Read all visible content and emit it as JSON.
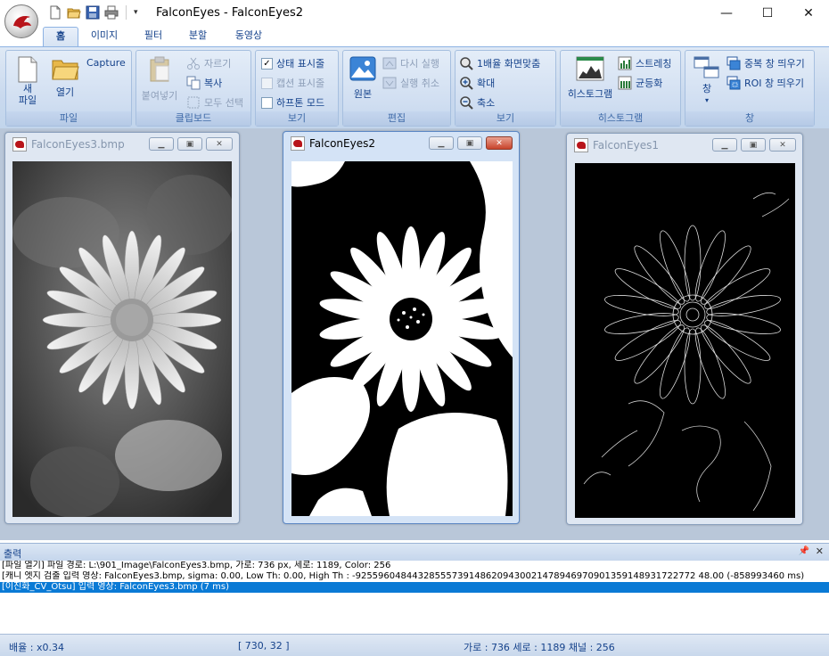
{
  "window": {
    "title": "FalconEyes - FalconEyes2"
  },
  "quick_access": {
    "icons": [
      "new-doc-icon",
      "open-folder-icon",
      "save-icon",
      "print-icon"
    ],
    "dropdown": "▾"
  },
  "window_controls": {
    "minimize": "—",
    "maximize": "☐",
    "close": "✕"
  },
  "tabs": [
    {
      "label": "홈",
      "active": true
    },
    {
      "label": "이미지",
      "active": false
    },
    {
      "label": "필터",
      "active": false
    },
    {
      "label": "분할",
      "active": false
    },
    {
      "label": "동영상",
      "active": false
    }
  ],
  "ribbon": {
    "file": {
      "label": "파일",
      "new_line1": "새",
      "new_line2": "파일",
      "open": "열기",
      "capture": "Capture"
    },
    "clipboard": {
      "label": "클립보드",
      "paste": "붙여넣기",
      "cut": "자르기",
      "copy": "복사",
      "select_all": "모두 선택"
    },
    "view1": {
      "label": "보기",
      "statusbar": "상태 표시줄",
      "captionbar": "캡션 표시줄",
      "halftone": "하프톤 모드"
    },
    "edit": {
      "label": "편집",
      "original": "원본",
      "redo": "다시 실행",
      "undo": "실행 취소"
    },
    "view2": {
      "label": "보기",
      "fit": "1배율  화면맞춤",
      "zoom_in": "확대",
      "zoom_out": "축소"
    },
    "histogram": {
      "label": "히스토그램",
      "histogram": "히스토그램",
      "stretching": "스트레칭",
      "equalize": "균등화"
    },
    "window": {
      "label": "창",
      "window_btn": "창",
      "window_arrow": "▾",
      "dup": "중복 창 띄우기",
      "roi": "ROI 창 띄우기"
    }
  },
  "child_windows": [
    {
      "title": "FalconEyes3.bmp",
      "active": false
    },
    {
      "title": "FalconEyes2",
      "active": true
    },
    {
      "title": "FalconEyes1",
      "active": false
    }
  ],
  "output_panel": {
    "title": "출력",
    "pin": "ᵖ",
    "close": "✕",
    "lines": [
      {
        "text": "[파일 열기] 파일 경로: L:\\901_Image\\FalconEyes3.bmp, 가로: 736 px, 세로: 1189, Color: 256",
        "selected": false
      },
      {
        "text": "[캐니 엣지 검출 입력 영상: FalconEyes3.bmp, sigma: 0.00, Low Th: 0.00, High Th : -925596048443285557391486209430021478946970901359148931722772 48.00 (-858993460 ms)",
        "selected": false
      },
      {
        "text": "[이진화_CV_Otsu] 입력 영상: FalconEyes3.bmp (7 ms)",
        "selected": true
      }
    ]
  },
  "status_bar": {
    "zoom": "배율 : x0.34",
    "coords": "[ 730, 32 ]",
    "info": "가로 : 736  세로 : 1189  채널 : 256"
  },
  "colors": {
    "ribbon_text": "#15428b",
    "selection": "#0a7ad5",
    "workspace": "#b9c7d9"
  }
}
